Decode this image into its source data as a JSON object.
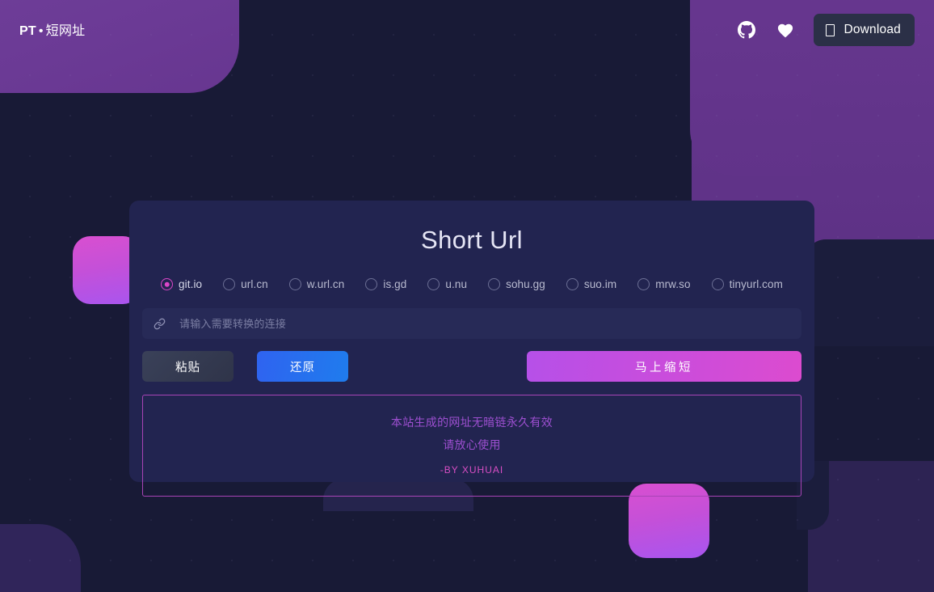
{
  "brand": {
    "prefix": "PT",
    "separator": "•",
    "name": "短网址"
  },
  "topbar": {
    "github_icon": "github-icon",
    "heart_icon": "heart-icon",
    "download_label": "Download",
    "download_icon": "missing-glyph-icon"
  },
  "card": {
    "title": "Short Url",
    "providers": [
      {
        "label": "git.io",
        "selected": true
      },
      {
        "label": "url.cn",
        "selected": false
      },
      {
        "label": "w.url.cn",
        "selected": false
      },
      {
        "label": "is.gd",
        "selected": false
      },
      {
        "label": "u.nu",
        "selected": false
      },
      {
        "label": "sohu.gg",
        "selected": false
      },
      {
        "label": "suo.im",
        "selected": false
      },
      {
        "label": "mrw.so",
        "selected": false
      },
      {
        "label": "tinyurl.com",
        "selected": false
      }
    ],
    "input": {
      "icon": "link-icon",
      "placeholder": "请输入需要转换的连接",
      "value": ""
    },
    "buttons": {
      "paste": "粘贴",
      "restore": "还原",
      "shorten": "马上缩短"
    },
    "notice": {
      "line1": "本站生成的网址无暗链永久有效",
      "line2": "请放心使用",
      "signature": "-BY XUHUAI"
    }
  },
  "colors": {
    "page_bg": "#181a36",
    "card_bg": "#222450",
    "accent_magenta": "#dc46c8",
    "accent_purple": "#6f3f99",
    "blue_button": "#2f63f0",
    "notice_border": "#a844b6"
  }
}
